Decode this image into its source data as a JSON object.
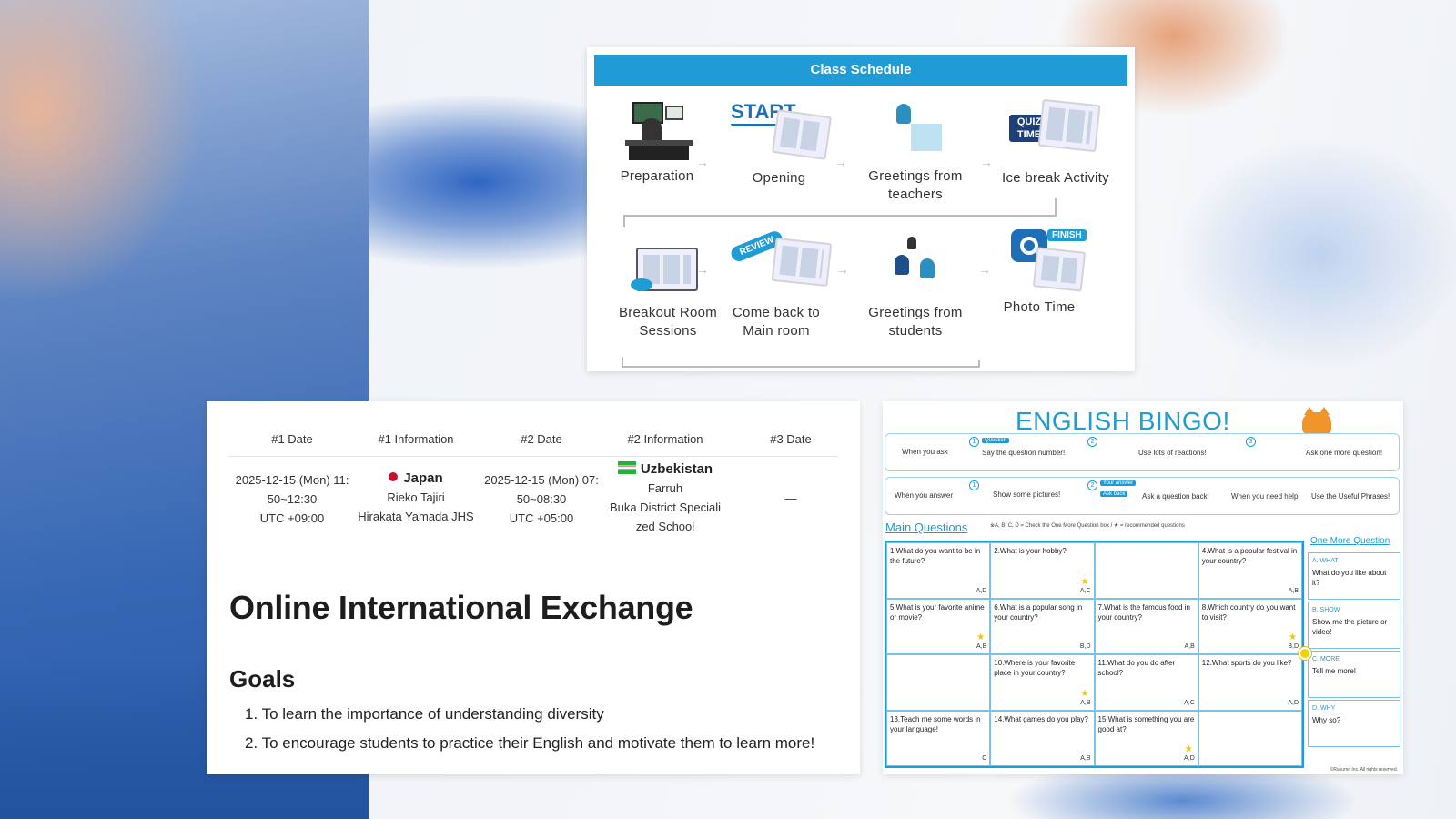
{
  "schedule": {
    "title": "Class Schedule",
    "steps": [
      {
        "label": "Preparation",
        "badge": ""
      },
      {
        "label": "Opening",
        "badge": "START"
      },
      {
        "label": "Greetings from teachers",
        "badge": ""
      },
      {
        "label": "Ice break Activity",
        "badge": "QUIZ TIME"
      },
      {
        "label": "Breakout Room Sessions",
        "badge": ""
      },
      {
        "label": "Come back to Main room",
        "badge": "REVIEW"
      },
      {
        "label": "Greetings from students",
        "badge": ""
      },
      {
        "label": "Photo Time",
        "badge": "FINISH"
      }
    ]
  },
  "info": {
    "headers": [
      "#1 Date",
      "#1 Information",
      "#2 Date",
      "#2 Information",
      "#3 Date"
    ],
    "date1": {
      "line1": "2025-12-15 (Mon) 11:",
      "line2": "50~12:30",
      "tz": "UTC +09:00"
    },
    "info1": {
      "country": "Japan",
      "name": "Rieko Tajiri",
      "school": "Hirakata Yamada JHS"
    },
    "date2": {
      "line1": "2025-12-15 (Mon) 07:",
      "line2": "50~08:30",
      "tz": "UTC +05:00"
    },
    "info2": {
      "country": "Uzbekistan",
      "name": "Farruh",
      "school1": "Buka District Speciali",
      "school2": "zed School"
    },
    "date3": "—",
    "title": "Online International Exchange",
    "goals_heading": "Goals",
    "goals": [
      "1. To learn the importance of understanding diversity",
      "2. To encourage students to practice their English and motivate them to learn more!"
    ]
  },
  "bingo": {
    "title": "ENGLISH BINGO!",
    "rules": {
      "when_ask": "When you ask",
      "say_number": "Say the question number!",
      "reactions": "Use lots of reactions!",
      "ask_more": "Ask one more question!",
      "when_answer": "When you answer",
      "show_pictures": "Show some pictures!",
      "ask_back": "Ask a question back!",
      "when_help": "When you need help",
      "useful_phrases": "Use the Useful Phrases!",
      "tag_question": "Question",
      "tag_answer": "Your answer",
      "tag_ask": "Ask back"
    },
    "main_questions": "Main Questions",
    "note": "※A, B, C, D = Check the One More Question box / ★ = recommended questions",
    "cells": [
      {
        "q": "1.What do you want to be in the future?",
        "ab": "A,D",
        "star": false
      },
      {
        "q": "2.What is your hobby?",
        "ab": "A,C",
        "star": true
      },
      {
        "q": "",
        "ab": "",
        "star": false
      },
      {
        "q": "4.What is a popular festival in your country?",
        "ab": "A,B",
        "star": false
      },
      {
        "q": "5.What is your favorite anime or movie?",
        "ab": "A,B",
        "star": true
      },
      {
        "q": "6.What is a popular song in your country?",
        "ab": "B,D",
        "star": false
      },
      {
        "q": "7.What is the famous food in your country?",
        "ab": "A,B",
        "star": false
      },
      {
        "q": "8.Which country do you want to visit?",
        "ab": "B,D",
        "star": true
      },
      {
        "q": "",
        "ab": "",
        "star": false
      },
      {
        "q": "10.Where is your favorite place in your country?",
        "ab": "A,B",
        "star": true
      },
      {
        "q": "11.What do you do after school?",
        "ab": "A,C",
        "star": false
      },
      {
        "q": "12.What sports do you like?",
        "ab": "A,D",
        "star": false
      },
      {
        "q": "13.Teach me some words in your language!",
        "ab": "C",
        "star": false
      },
      {
        "q": "14.What games do you play?",
        "ab": "A,B",
        "star": false
      },
      {
        "q": "15.What is something you are good at?",
        "ab": "A,D",
        "star": true
      },
      {
        "q": "",
        "ab": "",
        "star": false
      }
    ],
    "one_more": "One More Question",
    "side": [
      {
        "tag": "A. WHAT",
        "text": "What do you like about it?"
      },
      {
        "tag": "B. SHOW",
        "text": "Show me the picture or video!"
      },
      {
        "tag": "C. MORE",
        "text": "Tell me more!"
      },
      {
        "tag": "D. WHY",
        "text": "Why so?"
      }
    ],
    "footer": "©Rakumo Inc. All rights reserved."
  },
  "colors": {
    "accent": "#1f9bd5",
    "background_blue": "#2a5aa8"
  }
}
